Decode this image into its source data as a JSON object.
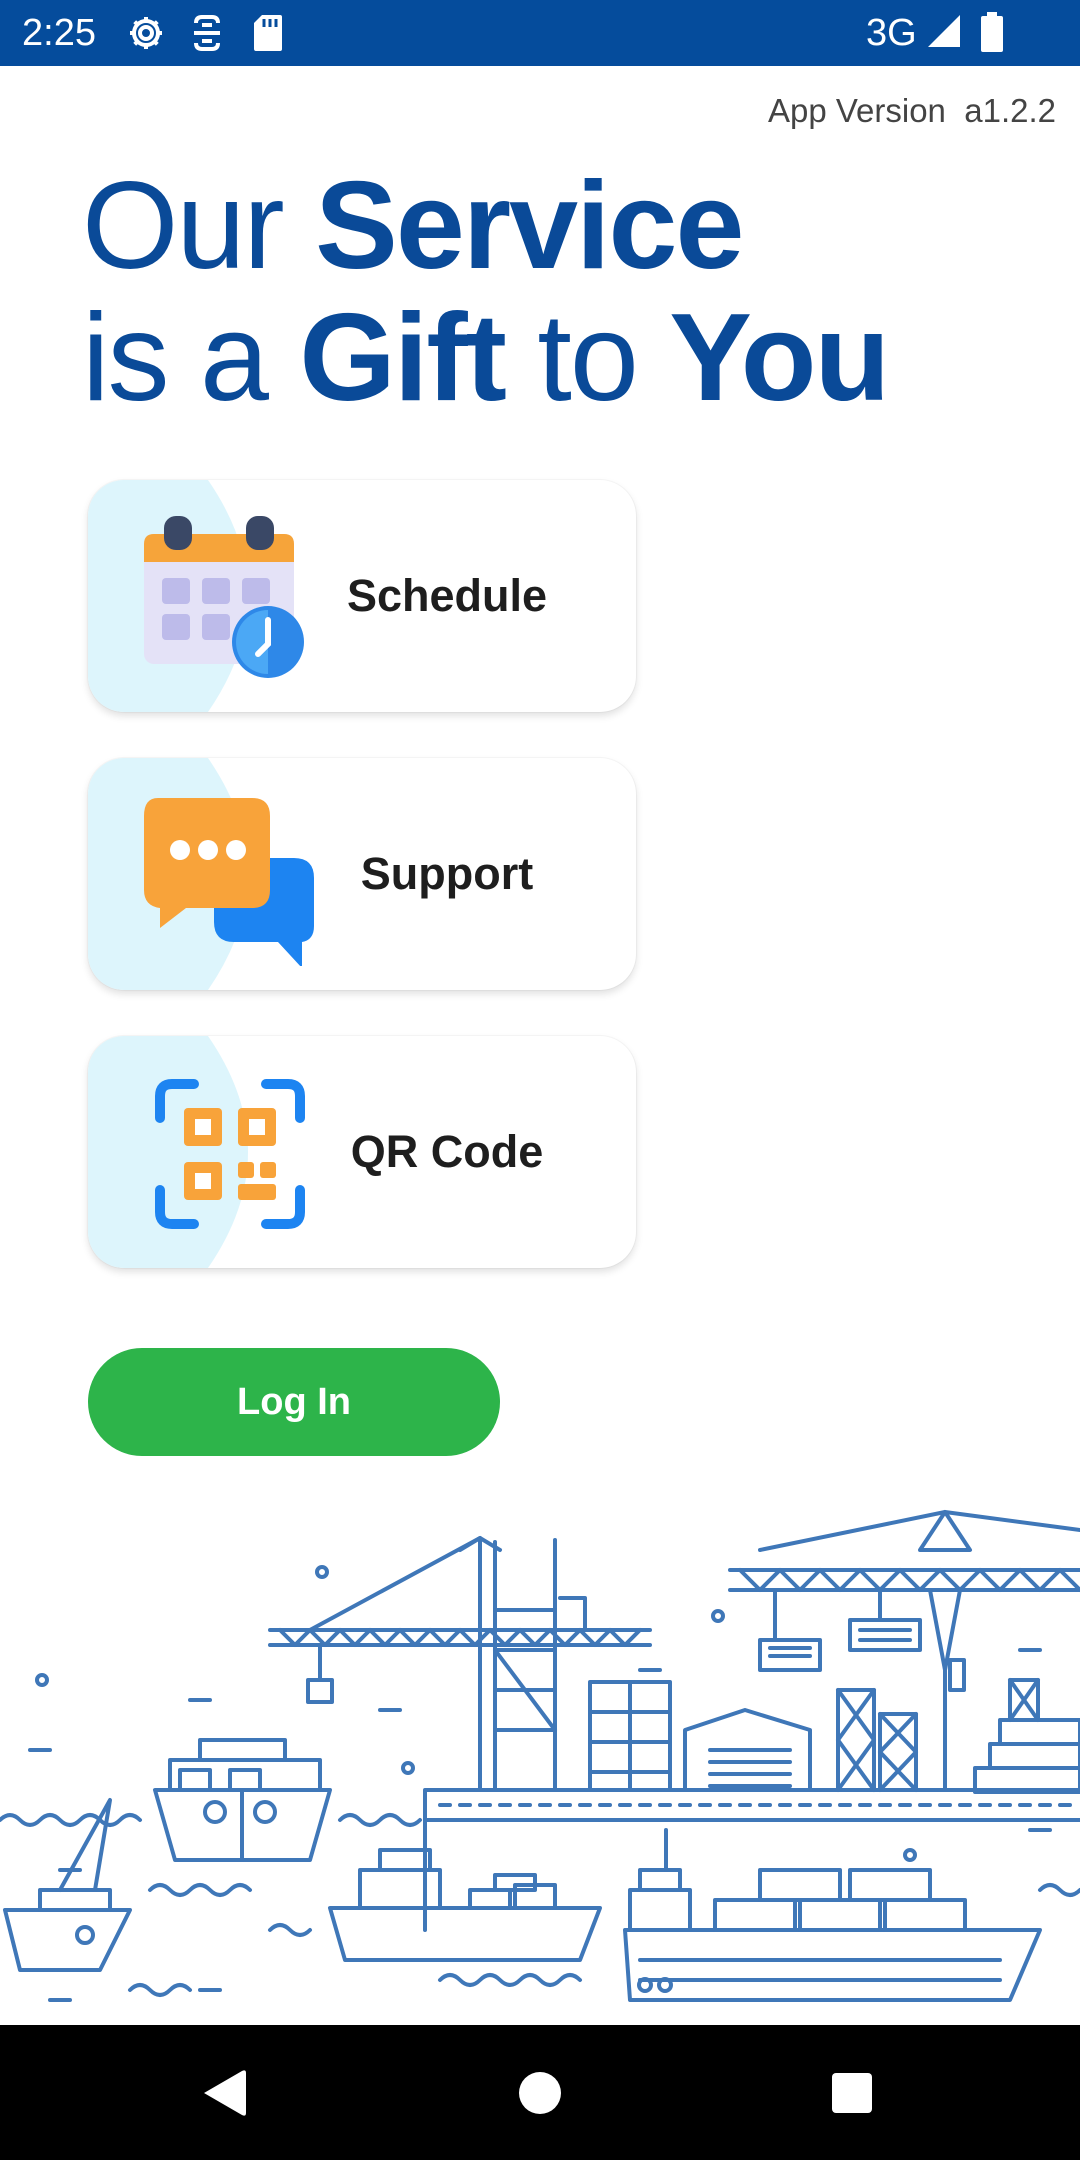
{
  "status_bar": {
    "time": "2:25",
    "network": "3G",
    "icons": [
      "gear-icon",
      "sim-icon",
      "sd-card-icon",
      "signal-icon",
      "battery-icon"
    ]
  },
  "app_version": {
    "text": "App Version  a1.2.2"
  },
  "headline": {
    "line1_light": "Our ",
    "line1_bold": "Service",
    "line2_light1": "is a ",
    "line2_bold1": "Gift",
    "line2_light2": " to ",
    "line2_bold2": "You"
  },
  "cards": [
    {
      "label": "Schedule",
      "icon": "calendar-clock-icon"
    },
    {
      "label": "Support",
      "icon": "chat-bubbles-icon"
    },
    {
      "label": "QR Code",
      "icon": "qr-code-icon"
    }
  ],
  "login": {
    "label": "Log In"
  },
  "nav": {
    "icons": [
      "back-icon",
      "home-icon",
      "recents-icon"
    ]
  },
  "colors": {
    "status_bar": "#054c9c",
    "headline": "#0a4a98",
    "login": "#2db44a",
    "card_accent": "#ddf5fc",
    "illustration": "#3f77b8"
  }
}
